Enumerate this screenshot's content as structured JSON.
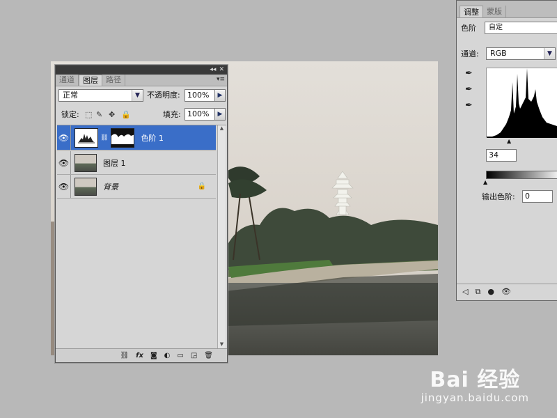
{
  "layers_panel": {
    "tabs": [
      "通道",
      "图层",
      "路径"
    ],
    "blend_mode": "正常",
    "opacity_label": "不透明度:",
    "opacity_value": "100%",
    "lock_label": "锁定:",
    "fill_label": "填充:",
    "fill_value": "100%",
    "layers": [
      {
        "name": "色阶 1",
        "selected": true
      },
      {
        "name": "图层 1",
        "selected": false
      },
      {
        "name": "背景",
        "selected": false
      }
    ],
    "footer_icons": [
      "link-icon",
      "fx-icon",
      "mask-icon",
      "adjustment-icon",
      "folder-icon",
      "new-layer-icon",
      "trash-icon"
    ]
  },
  "adjustments_panel": {
    "tabs": [
      "调整",
      "蒙版"
    ],
    "adjustment_label": "色阶",
    "preset_value": "自定",
    "channel_label": "通道:",
    "channel_value": "RGB",
    "input_black": "34",
    "output_label": "输出色阶:",
    "output_black": "0"
  },
  "watermark": {
    "logo": "Bai 经验",
    "url": "jingyan.baidu.com"
  },
  "colors": {
    "selected_layer": "#3a6ec8",
    "panel_bg": "#d6d6d6",
    "workspace": "#b8b8b8"
  }
}
